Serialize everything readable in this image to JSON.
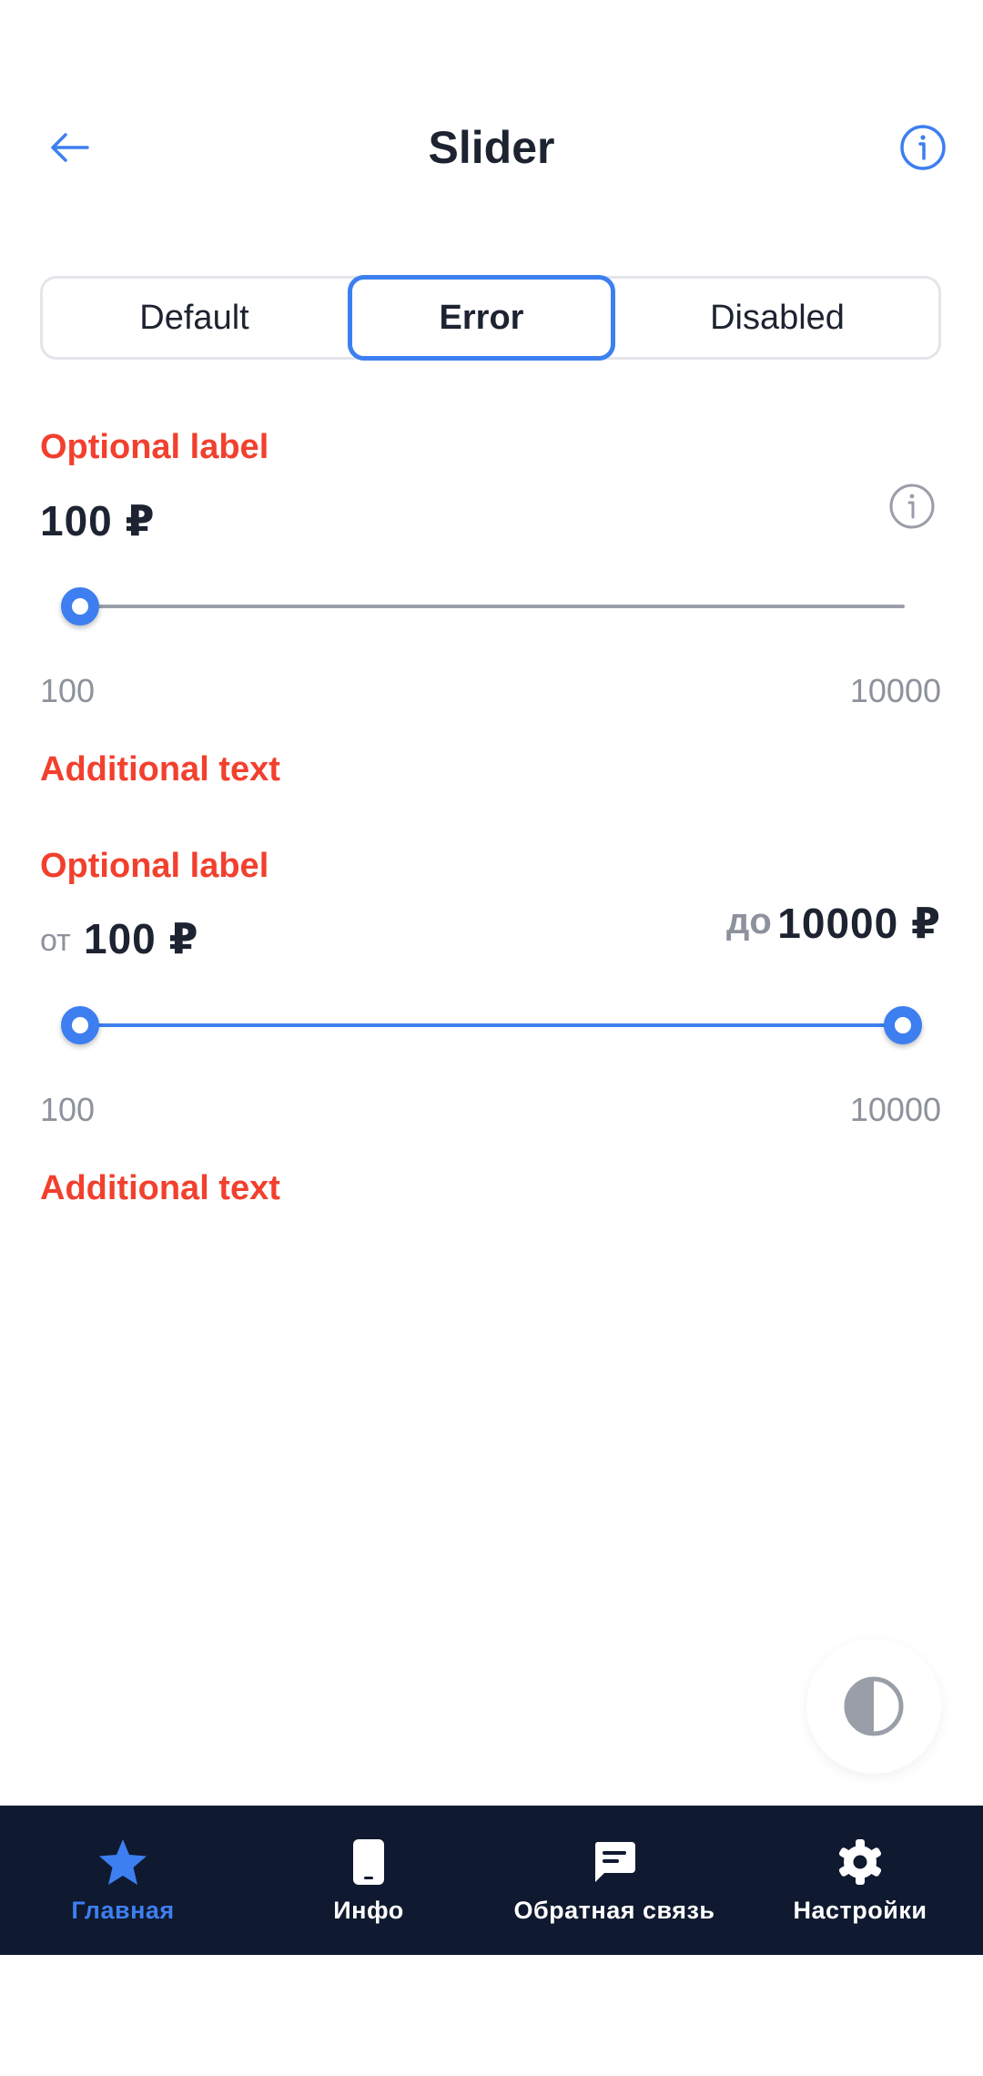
{
  "header": {
    "title": "Slider"
  },
  "tabs": [
    {
      "label": "Default",
      "selected": false
    },
    {
      "label": "Error",
      "selected": true
    },
    {
      "label": "Disabled",
      "selected": false
    }
  ],
  "single_slider": {
    "label": "Optional label",
    "value": "100 ₽",
    "min": "100",
    "max": "10000",
    "current": 100,
    "additional_text": "Additional text"
  },
  "range_slider": {
    "label": "Optional label",
    "from_prefix": "от",
    "from_value": "100 ₽",
    "to_prefix": "до",
    "to_value": "10000 ₽",
    "min": "100",
    "max": "10000",
    "low": 100,
    "high": 10000,
    "additional_text": "Additional text"
  },
  "bottom_nav": {
    "items": [
      {
        "label": "Главная",
        "icon": "star-icon",
        "active": true
      },
      {
        "label": "Инфо",
        "icon": "phone-icon",
        "active": false
      },
      {
        "label": "Обратная связь",
        "icon": "chat-icon",
        "active": false
      },
      {
        "label": "Настройки",
        "icon": "gear-icon",
        "active": false
      }
    ]
  },
  "colors": {
    "accent": "#3d7ff0",
    "error": "#f2402e",
    "nav_background": "#0f1930",
    "muted_text": "#8d929c",
    "track_inactive": "#9a9ea8"
  }
}
